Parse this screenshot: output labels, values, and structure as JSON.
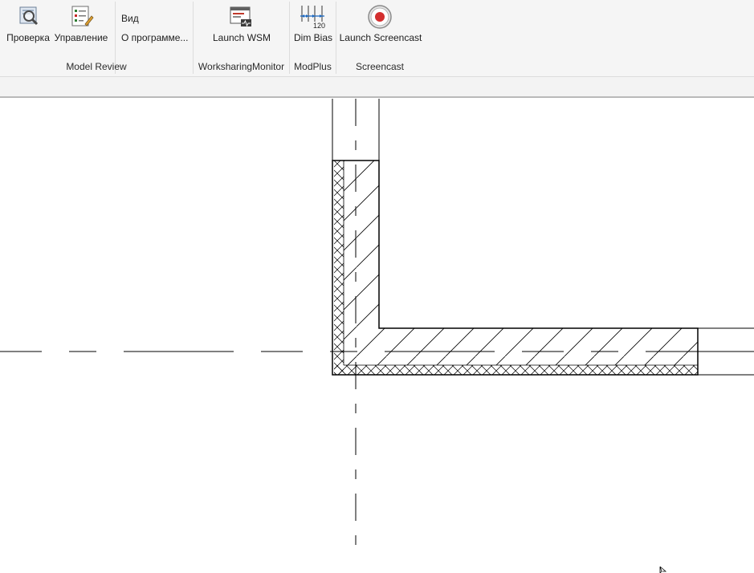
{
  "ribbon": {
    "groups": {
      "model_review": {
        "label": "Model Review",
        "buttons": {
          "check": "Проверка",
          "manage": "Управление",
          "view": "Вид",
          "about": "О программе..."
        }
      },
      "worksharing": {
        "label": "WorksharingMonitor",
        "launch": "Launch WSM"
      },
      "modplus": {
        "label": "ModPlus",
        "dim_bias": "Dim Bias",
        "dim_icon_text": "120"
      },
      "screencast": {
        "label": "Screencast",
        "launch": "Launch Screencast"
      }
    }
  },
  "icons": {
    "check": "magnifier-review-icon",
    "manage": "checklist-edit-icon",
    "wsm": "monitor-window-icon",
    "dim_bias": "dimension-ruler-icon",
    "screencast": "record-icon",
    "cursor": "mouse-cursor-icon"
  },
  "colors": {
    "ribbon_bg": "#f5f5f5",
    "record_red": "#d32f2f",
    "canvas_bg": "#ffffff",
    "line": "#000000"
  }
}
